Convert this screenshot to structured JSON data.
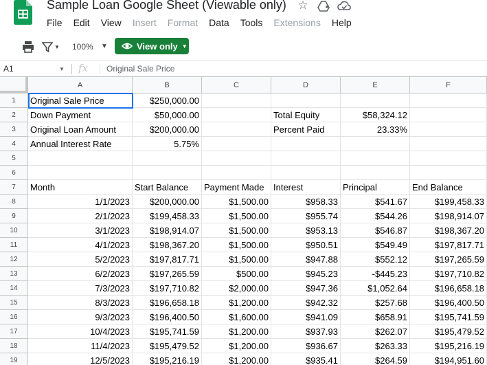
{
  "window": {
    "title": "Sample Loan Google Sheet (Viewable only)",
    "icons": [
      "star-icon",
      "move-to-drive-icon",
      "cloud-status-icon"
    ]
  },
  "menu": [
    {
      "label": "File",
      "enabled": true
    },
    {
      "label": "Edit",
      "enabled": true
    },
    {
      "label": "View",
      "enabled": true
    },
    {
      "label": "Insert",
      "enabled": false
    },
    {
      "label": "Format",
      "enabled": false
    },
    {
      "label": "Data",
      "enabled": true
    },
    {
      "label": "Tools",
      "enabled": true
    },
    {
      "label": "Extensions",
      "enabled": false
    },
    {
      "label": "Help",
      "enabled": true
    }
  ],
  "toolbar": {
    "zoom": "100%",
    "view_mode_label": "View only"
  },
  "formula_bar": {
    "name_box": "A1",
    "fx_label": "fx",
    "formula": "Original Sale Price"
  },
  "colors": {
    "view_button": "#188038",
    "selection": "#1a73e8",
    "sheets_green": "#0f9d58"
  },
  "columns": [
    "A",
    "B",
    "C",
    "D",
    "E",
    "F"
  ],
  "rows": [
    {
      "num": "1",
      "cells": [
        "Original Sale Price",
        "$250,000.00",
        "",
        "",
        "",
        ""
      ]
    },
    {
      "num": "2",
      "cells": [
        "Down Payment",
        "$50,000.00",
        "",
        "Total Equity",
        "$58,324.12",
        ""
      ]
    },
    {
      "num": "3",
      "cells": [
        "Original Loan Amount",
        "$200,000.00",
        "",
        "Percent Paid",
        "23.33%",
        ""
      ]
    },
    {
      "num": "4",
      "cells": [
        "Annual Interest Rate",
        "5.75%",
        "",
        "",
        "",
        ""
      ]
    },
    {
      "num": "5",
      "cells": [
        "",
        "",
        "",
        "",
        "",
        ""
      ]
    },
    {
      "num": "6",
      "cells": [
        "",
        "",
        "",
        "",
        "",
        ""
      ]
    },
    {
      "num": "7",
      "cells": [
        "Month",
        "Start Balance",
        "Payment Made",
        "Interest",
        "Principal",
        "End Balance"
      ]
    },
    {
      "num": "8",
      "cells": [
        "1/1/2023",
        "$200,000.00",
        "$1,500.00",
        "$958.33",
        "$541.67",
        "$199,458.33"
      ]
    },
    {
      "num": "9",
      "cells": [
        "2/1/2023",
        "$199,458.33",
        "$1,500.00",
        "$955.74",
        "$544.26",
        "$198,914.07"
      ]
    },
    {
      "num": "10",
      "cells": [
        "3/1/2023",
        "$198,914.07",
        "$1,500.00",
        "$953.13",
        "$546.87",
        "$198,367.20"
      ]
    },
    {
      "num": "11",
      "cells": [
        "4/1/2023",
        "$198,367.20",
        "$1,500.00",
        "$950.51",
        "$549.49",
        "$197,817.71"
      ]
    },
    {
      "num": "12",
      "cells": [
        "5/2/2023",
        "$197,817.71",
        "$1,500.00",
        "$947.88",
        "$552.12",
        "$197,265.59"
      ]
    },
    {
      "num": "13",
      "cells": [
        "6/2/2023",
        "$197,265.59",
        "$500.00",
        "$945.23",
        "-$445.23",
        "$197,710.82"
      ]
    },
    {
      "num": "14",
      "cells": [
        "7/3/2023",
        "$197,710.82",
        "$2,000.00",
        "$947.36",
        "$1,052.64",
        "$196,658.18"
      ]
    },
    {
      "num": "15",
      "cells": [
        "8/3/2023",
        "$196,658.18",
        "$1,200.00",
        "$942.32",
        "$257.68",
        "$196,400.50"
      ]
    },
    {
      "num": "16",
      "cells": [
        "9/3/2023",
        "$196,400.50",
        "$1,600.00",
        "$941.09",
        "$658.91",
        "$195,741.59"
      ]
    },
    {
      "num": "17",
      "cells": [
        "10/4/2023",
        "$195,741.59",
        "$1,200.00",
        "$937.93",
        "$262.07",
        "$195,479.52"
      ]
    },
    {
      "num": "18",
      "cells": [
        "11/4/2023",
        "$195,479.52",
        "$1,200.00",
        "$936.67",
        "$263.33",
        "$195,216.19"
      ]
    },
    {
      "num": "19",
      "cells": [
        "12/5/2023",
        "$195,216.19",
        "$1,200.00",
        "$935.41",
        "$264.59",
        "$194,951.60"
      ]
    }
  ]
}
